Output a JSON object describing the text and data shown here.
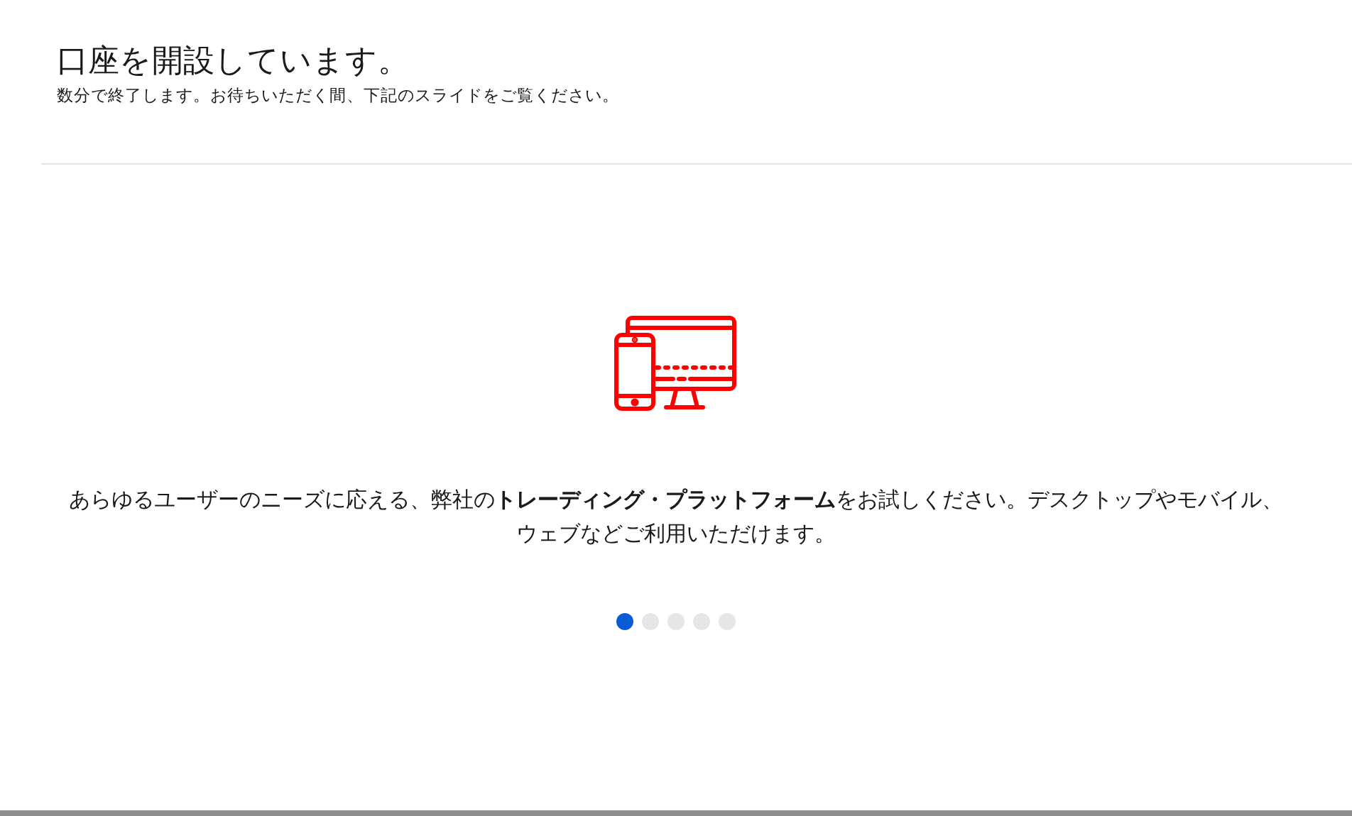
{
  "header": {
    "title": "口座を開設しています。",
    "subtitle": "数分で終了します。お待ちいただく間、下記のスライドをご覧ください。"
  },
  "slide": {
    "text": "あらゆるユーザーのニーズに応える、弊社の**トレーディング・プラットフォーム**をお試しください。デスクトップやモバイル、ウェブなどご利用いただけます。"
  },
  "pagination": [
    {
      "selected": true
    },
    {
      "selected": false
    },
    {
      "selected": false
    },
    {
      "selected": false
    },
    {
      "selected": false
    }
  ]
}
